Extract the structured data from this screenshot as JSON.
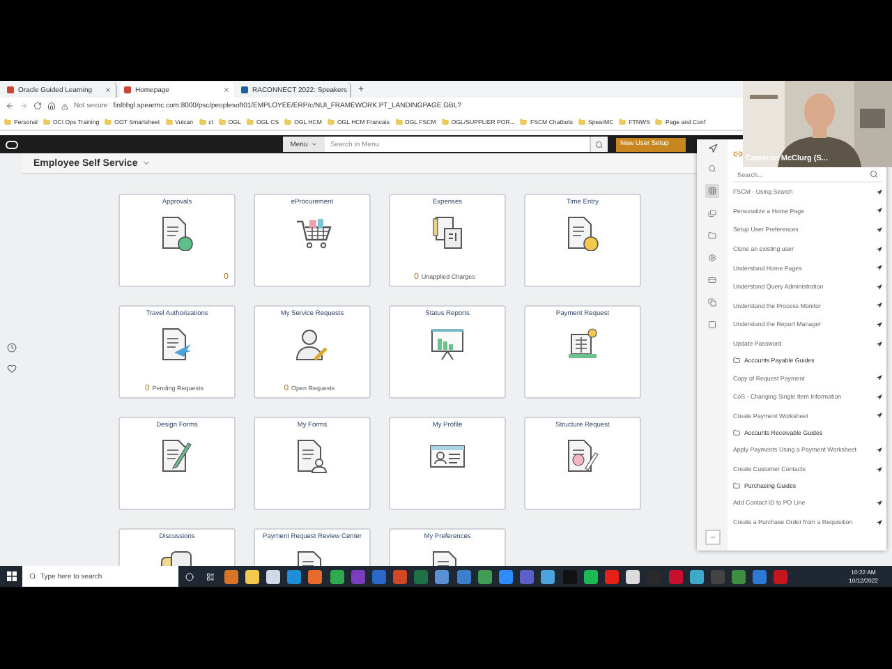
{
  "browser": {
    "tabs": [
      {
        "title": "Oracle Guided Learning",
        "selected": false
      },
      {
        "title": "Homepage",
        "selected": true
      },
      {
        "title": "RACONNECT 2022: Speakers",
        "selected": false
      }
    ],
    "new_tab": "+",
    "address": {
      "security": "Not secure",
      "url": "finlbbgl.spearmc.com:8000/psc/peoplesoft01/EMPLOYEE/ERP/c/NUI_FRAMEWORK.PT_LANDINGPAGE.GBL?"
    },
    "bookmarks": [
      "Personal",
      "OCI Ops Training",
      "OOT Smartsheet",
      "Vulcan",
      "ct",
      "OGL",
      "OGL CS",
      "OGL HCM",
      "OGL HCM Francais",
      "OGL FSCM",
      "OGL/SUPPLIER POR...",
      "FSCM Chatbots",
      "SpearMC",
      "FTNWS",
      "Page and Conf"
    ]
  },
  "header": {
    "menu": "Menu",
    "search_placeholder": "Search in Menu",
    "new_user_setup": "New User Setup"
  },
  "page_title": "Employee Self Service",
  "tiles": [
    {
      "title": "Approvals",
      "count": "0"
    },
    {
      "title": "eProcurement"
    },
    {
      "title": "Expenses",
      "count": "0",
      "count_label": "Unapplied Charges"
    },
    {
      "title": "Time Entry"
    },
    {
      "title": "Travel Authorizations",
      "count": "0",
      "count_label": "Pending Requests"
    },
    {
      "title": "My Service Requests",
      "count": "0",
      "count_label": "Open Requests"
    },
    {
      "title": "Status Reports"
    },
    {
      "title": "Payment Request"
    },
    {
      "title": "Design Forms"
    },
    {
      "title": "My Forms"
    },
    {
      "title": "My Profile"
    },
    {
      "title": "Structure Request"
    },
    {
      "title": "Discussions"
    },
    {
      "title": "Payment Request Review Center"
    },
    {
      "title": "My Preferences"
    }
  ],
  "guide_panel": {
    "search_placeholder": "Search...",
    "items": [
      {
        "kind": "guide",
        "label": "FSCM - Using Search"
      },
      {
        "kind": "guide",
        "label": "Personalize a Home Page"
      },
      {
        "kind": "guide",
        "label": "Setup User Preferences"
      },
      {
        "kind": "guide",
        "label": "Clone an existing user"
      },
      {
        "kind": "guide",
        "label": "Understand Home Pages"
      },
      {
        "kind": "guide",
        "label": "Understand Query Administration"
      },
      {
        "kind": "guide",
        "label": "Understand the Process Monitor"
      },
      {
        "kind": "guide",
        "label": "Understand the Report Manager"
      },
      {
        "kind": "guide",
        "label": "Update Password"
      },
      {
        "kind": "section",
        "label": "Accounts Payable Guides"
      },
      {
        "kind": "guide",
        "label": "Copy of Request Payment"
      },
      {
        "kind": "guide",
        "label": "CoS - Changing Single Item Information"
      },
      {
        "kind": "guide",
        "label": "Create Payment Worksheet"
      },
      {
        "kind": "section",
        "label": "Accounts Receivable Guides"
      },
      {
        "kind": "guide",
        "label": "Apply Payments Using a Payment Worksheet"
      },
      {
        "kind": "guide",
        "label": "Create Customer Contacts"
      },
      {
        "kind": "section",
        "label": "Purchasing Guides"
      },
      {
        "kind": "guide",
        "label": "Add Contact ID to PO Line"
      },
      {
        "kind": "guide",
        "label": "Create a Purchase Order from a Requisition"
      }
    ]
  },
  "webcam": {
    "name": "Cameron McClurg (S..."
  },
  "taskbar": {
    "search_placeholder": "Type here to search",
    "time": "10:22 AM",
    "date": "10/12/2022"
  }
}
